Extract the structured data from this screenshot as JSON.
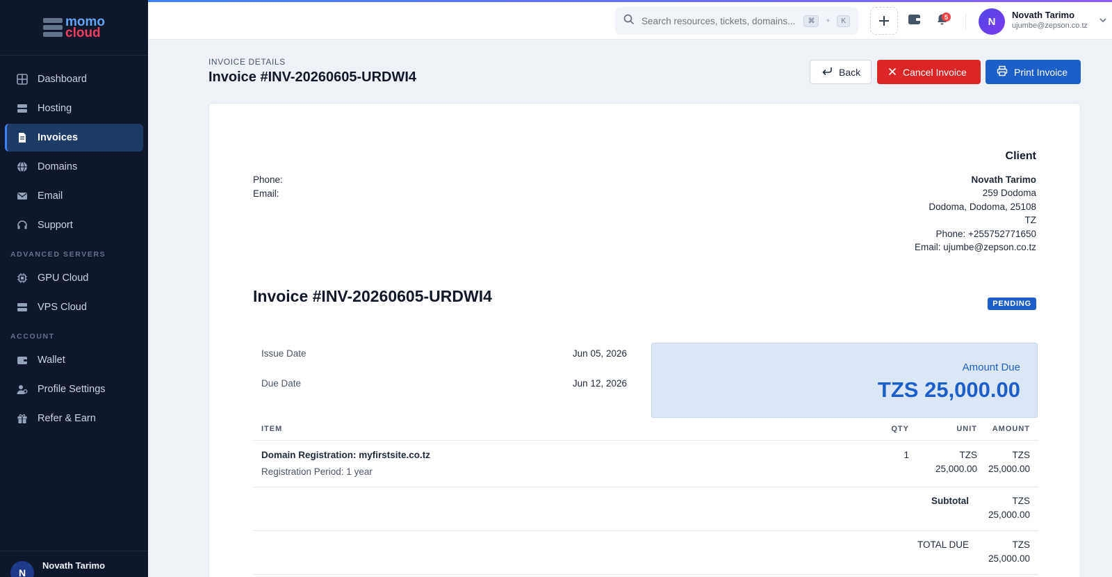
{
  "brand": {
    "line1": "momo",
    "line2": "cloud"
  },
  "sidebar": {
    "items": [
      {
        "label": "Dashboard"
      },
      {
        "label": "Hosting"
      },
      {
        "label": "Invoices"
      },
      {
        "label": "Domains"
      },
      {
        "label": "Email"
      },
      {
        "label": "Support"
      }
    ],
    "section_advanced": "ADVANCED SERVERS",
    "advanced_items": [
      {
        "label": "GPU Cloud"
      },
      {
        "label": "VPS Cloud"
      }
    ],
    "section_account": "ACCOUNT",
    "account_items": [
      {
        "label": "Wallet"
      },
      {
        "label": "Profile Settings"
      },
      {
        "label": "Refer & Earn"
      }
    ],
    "active": "Invoices",
    "user": {
      "initial": "N",
      "name": "Novath Tarimo"
    }
  },
  "topbar": {
    "search_placeholder": "Search resources, tickets, domains...",
    "shortcut_key1": "⌘",
    "shortcut_plus": "+",
    "shortcut_key2": "K",
    "notifications_count": "5",
    "user": {
      "initial": "N",
      "name": "Novath Tarimo",
      "email": "ujumbe@zepson.co.tz"
    }
  },
  "page": {
    "subtitle": "INVOICE DETAILS",
    "title": "Invoice #INV-20260605-URDWI4",
    "buttons": {
      "back": "Back",
      "cancel": "Cancel Invoice",
      "print": "Print Invoice"
    }
  },
  "invoice": {
    "from": {
      "phone_label": "Phone:",
      "email_label": "Email:"
    },
    "client": {
      "title": "Client",
      "name": "Novath Tarimo",
      "address1": "259 Dodoma",
      "address2": "Dodoma, Dodoma, 25108",
      "country": "TZ",
      "phone": "Phone: +255752771650",
      "email": "Email: ujumbe@zepson.co.tz"
    },
    "heading": "Invoice #INV-20260605-URDWI4",
    "status": "PENDING",
    "issue_date_label": "Issue Date",
    "issue_date": "Jun 05, 2026",
    "due_date_label": "Due Date",
    "due_date": "Jun 12, 2026",
    "amount_due_label": "Amount Due",
    "amount_due": "TZS 25,000.00",
    "columns": {
      "item": "ITEM",
      "qty": "QTY",
      "unit": "UNIT",
      "amount": "AMOUNT"
    },
    "items": [
      {
        "name": "Domain Registration: myfirstsite.co.tz",
        "description": "Registration Period: 1 year",
        "qty": "1",
        "unit_currency": "TZS",
        "unit_value": "25,000.00",
        "amount_currency": "TZS",
        "amount_value": "25,000.00"
      }
    ],
    "subtotal_label": "Subtotal",
    "subtotal_currency": "TZS",
    "subtotal_value": "25,000.00",
    "total_label": "TOTAL DUE",
    "total_currency": "TZS",
    "total_value": "25,000.00"
  },
  "colors": {
    "accent": "#1d5fc9",
    "danger": "#dc2626",
    "sidebar_bg": "#0f172a"
  }
}
